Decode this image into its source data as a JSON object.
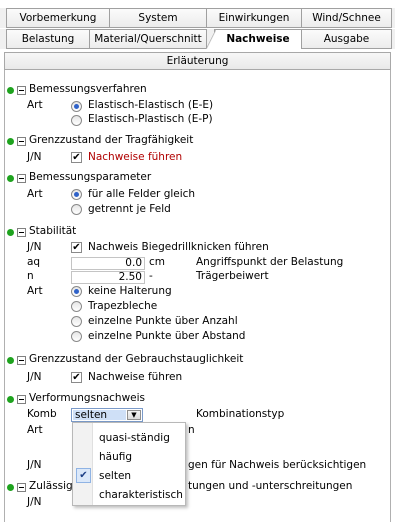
{
  "tabs": {
    "row1": [
      "Vorbemerkung",
      "System",
      "Einwirkungen",
      "Wind/Schnee"
    ],
    "row2": [
      "Belastung",
      "Material/Querschnitt",
      "Nachweise",
      "Ausgabe"
    ]
  },
  "erlaeuterung": "Erläuterung",
  "bemessungsverfahren": {
    "title": "Bemessungsverfahren",
    "label": "Art",
    "opt1": "Elastisch-Elastisch (E-E)",
    "opt2": "Elastisch-Plastisch (E-P)"
  },
  "gzt": {
    "title": "Grenzzustand der Tragfähigkeit",
    "label": "J/N",
    "check": "Nachweise führen"
  },
  "bemessungsparameter": {
    "title": "Bemessungsparameter",
    "label": "Art",
    "opt1": "für alle Felder gleich",
    "opt2": "getrennt je Feld"
  },
  "stabilitaet": {
    "title": "Stabilität",
    "jn_label": "J/N",
    "check": "Nachweis Biegedrillknicken führen",
    "aq_label": "aq",
    "aq_value": "0.0",
    "aq_unit": "cm",
    "aq_desc": "Angriffspunkt der Belastung",
    "n_label": "n",
    "n_value": "2.50",
    "n_unit": "-",
    "n_desc": "Trägerbeiwert",
    "art_label": "Art",
    "opt1": "keine Halterung",
    "opt2": "Trapezbleche",
    "opt3": "einzelne Punkte über Anzahl",
    "opt4": "einzelne Punkte über Abstand"
  },
  "gzg": {
    "title": "Grenzzustand der Gebrauchstauglichkeit",
    "label": "J/N",
    "check": "Nachweise führen"
  },
  "verformung": {
    "title": "Verformungsnachweis",
    "komb_label": "Komb",
    "komb_value": "selten",
    "komb_desc": "Kombinationstyp",
    "art_label": "Art",
    "art_partial": "n",
    "jn_label": "J/N",
    "jn_partial": "gen für Nachweis berücksichtigen"
  },
  "zulaessig": {
    "title_partial": "Zulässig",
    "title_rest": "tungen und -unterschreitungen",
    "label": "J/N"
  },
  "dropdown": {
    "items": [
      "quasi-ständig",
      "häufig",
      "selten",
      "charakteristisch"
    ],
    "checked": "selten"
  },
  "colors": {
    "dot": "#1ea31e",
    "red_text": "#b00000",
    "radio_on": "#2f62c9"
  }
}
